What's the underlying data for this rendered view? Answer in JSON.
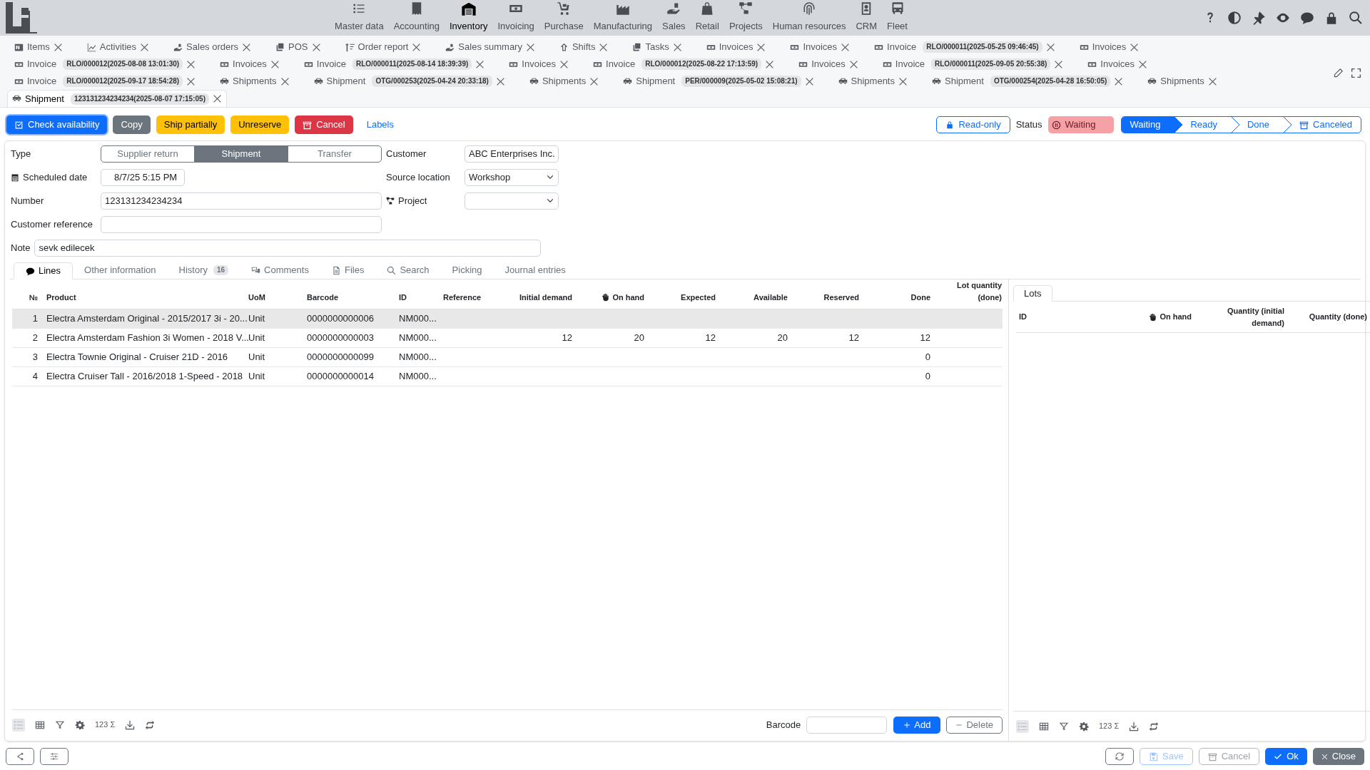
{
  "nav": {
    "items": [
      {
        "label": "Master data",
        "selected": false
      },
      {
        "label": "Accounting",
        "selected": false
      },
      {
        "label": "Inventory",
        "selected": true
      },
      {
        "label": "Invoicing",
        "selected": false
      },
      {
        "label": "Purchase",
        "selected": false
      },
      {
        "label": "Manufacturing",
        "selected": false
      },
      {
        "label": "Sales",
        "selected": false
      },
      {
        "label": "Retail",
        "selected": false
      },
      {
        "label": "Projects",
        "selected": false
      },
      {
        "label": "Human resources",
        "selected": false
      },
      {
        "label": "CRM",
        "selected": false
      },
      {
        "label": "Fleet",
        "selected": false
      }
    ]
  },
  "open_tabs": [
    [
      {
        "label": "Items",
        "selected": false
      },
      {
        "label": "Activities",
        "selected": false
      },
      {
        "label": "Sales orders",
        "selected": false
      },
      {
        "label": "POS",
        "selected": false
      },
      {
        "label": "Order report",
        "selected": false
      },
      {
        "label": "Sales summary",
        "selected": false
      },
      {
        "label": "Shifts",
        "selected": false
      },
      {
        "label": "Tasks",
        "selected": false
      },
      {
        "label": "Invoices",
        "selected": false
      },
      {
        "label": "Invoices",
        "selected": false
      },
      {
        "label": "Invoice",
        "badge": "RLO/000011(2025-05-25 09:46:45)",
        "selected": false
      },
      {
        "label": "Invoices",
        "selected": false
      }
    ],
    [
      {
        "label": "Invoice",
        "badge": "RLO/000012(2025-08-08 13:01:30)",
        "selected": false
      },
      {
        "label": "Invoices",
        "selected": false
      },
      {
        "label": "Invoice",
        "badge": "RLO/000011(2025-08-14 18:39:39)",
        "selected": false
      },
      {
        "label": "Invoices",
        "selected": false
      },
      {
        "label": "Invoice",
        "badge": "RLO/000012(2025-08-22 17:13:59)",
        "selected": false
      },
      {
        "label": "Invoices",
        "selected": false
      },
      {
        "label": "Invoice",
        "badge": "RLO/000011(2025-09-05 20:55:38)",
        "selected": false
      },
      {
        "label": "Invoices",
        "selected": false
      }
    ],
    [
      {
        "label": "Invoice",
        "badge": "RLO/000012(2025-09-17 18:54:28)",
        "selected": false
      },
      {
        "label": "Shipments",
        "selected": false
      },
      {
        "label": "Shipment",
        "badge": "OTG/000253(2025-04-24 20:33:18)",
        "selected": false
      },
      {
        "label": "Shipments",
        "selected": false
      },
      {
        "label": "Shipment",
        "badge": "PER/000009(2025-05-02 15:08:21)",
        "selected": false
      },
      {
        "label": "Shipments",
        "selected": false
      },
      {
        "label": "Shipment",
        "badge": "OTG/000254(2025-04-28 16:50:05)",
        "selected": false
      },
      {
        "label": "Shipments",
        "selected": false
      }
    ],
    [
      {
        "label": "Shipment",
        "badge": "123131234234234(2025-08-07 17:15:05)",
        "selected": true
      }
    ]
  ],
  "actions": [
    {
      "label": "Check availability",
      "kind": "primary"
    },
    {
      "label": "Copy",
      "kind": "secondary"
    },
    {
      "label": "Ship partially",
      "kind": "warning"
    },
    {
      "label": "Unreserve",
      "kind": "warning"
    },
    {
      "label": "Cancel",
      "kind": "danger"
    },
    {
      "label": "Labels",
      "kind": "link"
    }
  ],
  "read_only": "Read-only",
  "status": {
    "label": "Status",
    "value": "Waiting",
    "steps": [
      {
        "label": "Waiting",
        "selected": true
      },
      {
        "label": "Ready",
        "selected": false
      },
      {
        "label": "Done",
        "selected": false
      },
      {
        "label": "Canceled",
        "selected": false
      }
    ]
  },
  "form": {
    "type": {
      "label": "Type",
      "options": [
        {
          "label": "Supplier return",
          "selected": false
        },
        {
          "label": "Shipment",
          "selected": true
        },
        {
          "label": "Transfer",
          "selected": false
        }
      ]
    },
    "scheduled_date": {
      "label": "Scheduled date",
      "value": "8/7/25 5:15 PM"
    },
    "number": {
      "label": "Number",
      "value": "123131234234234"
    },
    "customer_reference": {
      "label": "Customer reference"
    },
    "note": {
      "label": "Note",
      "value": "sevk edilecek"
    },
    "customer": {
      "label": "Customer",
      "value": "ABC Enterprises Inc."
    },
    "source_location": {
      "label": "Source location",
      "value": "Workshop"
    },
    "project": {
      "label": "Project"
    }
  },
  "sub_tabs": [
    {
      "label": "Lines",
      "selected": true
    },
    {
      "label": "Other information",
      "selected": false
    },
    {
      "label": "History",
      "badge": "16",
      "selected": false
    },
    {
      "label": "Comments",
      "selected": false
    },
    {
      "label": "Files",
      "selected": false
    },
    {
      "label": "Search",
      "selected": false
    },
    {
      "label": "Picking",
      "selected": false
    },
    {
      "label": "Journal entries",
      "selected": false
    }
  ],
  "lines": {
    "columns": [
      "№",
      "Product",
      "UoM",
      "Barcode",
      "ID",
      "Reference",
      "Initial demand",
      "On hand",
      "Expected",
      "Available",
      "Reserved",
      "Done",
      "Lot quantity (done)"
    ],
    "rows": [
      {
        "selected": true,
        "cells": [
          "1",
          "Electra Amsterdam Original - 2015/2017 3i - 20...",
          "Unit",
          "0000000000006",
          "NM000...",
          "",
          "",
          "",
          "",
          "",
          "",
          "",
          ""
        ]
      },
      {
        "selected": false,
        "cells": [
          "2",
          "Electra Amsterdam Fashion 3i Women - 2018 V...",
          "Unit",
          "0000000000003",
          "NM000...",
          "",
          "12",
          "20",
          "12",
          "20",
          "12",
          "12",
          ""
        ]
      },
      {
        "selected": false,
        "cells": [
          "3",
          "Electra Townie Original - Cruiser 21D - 2016",
          "Unit",
          "0000000000099",
          "NM000...",
          "",
          "",
          "",
          "",
          "",
          "",
          "0",
          ""
        ]
      },
      {
        "selected": false,
        "cells": [
          "4",
          "Electra Cruiser Tall - 2016/2018 1-Speed - 2018",
          "Unit",
          "0000000000014",
          "NM000...",
          "",
          "",
          "",
          "",
          "",
          "",
          "0",
          ""
        ]
      }
    ],
    "totals": "123 Σ",
    "barcode_label": "Barcode",
    "add": "Add",
    "delete": "Delete"
  },
  "lots": {
    "tab": "Lots",
    "columns": [
      "ID",
      "On hand",
      "Quantity (initial demand)",
      "Quantity (done)"
    ],
    "totals": "123 Σ"
  },
  "footer": {
    "save": "Save",
    "cancel": "Cancel",
    "ok": "Ok",
    "close": "Close"
  }
}
